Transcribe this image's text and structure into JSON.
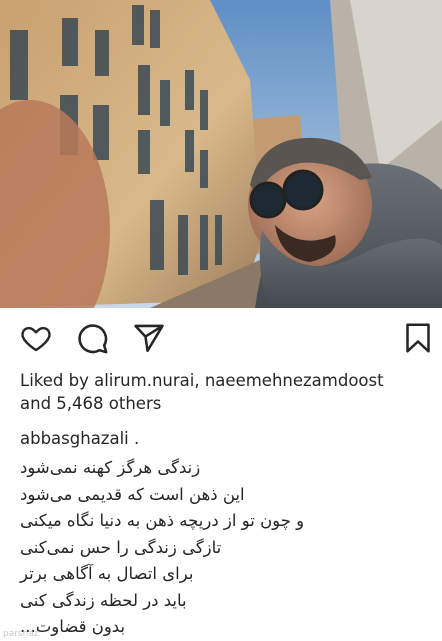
{
  "post": {
    "image_alt": "Selfie of a man wearing round sunglasses, a knit beanie and a grey scarf in front of a yellow historic building",
    "actions": {
      "like_icon": "heart-outline-icon",
      "comment_icon": "speech-bubble-icon",
      "share_icon": "paper-plane-icon",
      "save_icon": "bookmark-outline-icon"
    },
    "likes": {
      "prefix": "Liked by ",
      "user1": "alirum.nurai",
      "separator": ", ",
      "user2": "naeemehnezamdoost",
      "and": "and ",
      "count": "5,468 others"
    },
    "caption": {
      "username": "abbasghazali .",
      "lines": [
        "زندگی هرگز کهنه نمی‌شود",
        "این ذهن است که قدیمی می‌شود",
        "و چون تو از دریچه ذهن به دنیا نگاه میکنی",
        "تازگی زندگی را حس نمی‌کنی",
        "برای اتصال به آگاهی برتر",
        "باید در لحظه زندگی کنی",
        "بدون قضاوت..."
      ]
    }
  },
  "watermark": "parsnaz",
  "colors": {
    "text": "#262626",
    "icon": "#262626",
    "background": "#ffffff"
  }
}
